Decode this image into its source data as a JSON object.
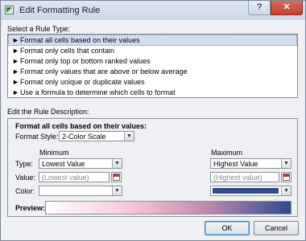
{
  "window": {
    "title": "Edit Formatting Rule",
    "help_label": "?",
    "close_label": "✕"
  },
  "select_rule_type": {
    "label": "Select a Rule Type:",
    "items": [
      {
        "label": "Format all cells based on their values",
        "selected": true
      },
      {
        "label": "Format only cells that contain",
        "selected": false
      },
      {
        "label": "Format only top or bottom ranked values",
        "selected": false
      },
      {
        "label": "Format only values that are above or below average",
        "selected": false
      },
      {
        "label": "Format only unique or duplicate values",
        "selected": false
      },
      {
        "label": "Use a formula to determine which cells to format",
        "selected": false
      }
    ],
    "arrow_glyph": "►"
  },
  "edit_description": {
    "label": "Edit the Rule Description:",
    "heading": "Format all cells based on their values:",
    "format_style_label": "Format Style:",
    "format_style_value": "2-Color Scale",
    "minimum_header": "Minimum",
    "maximum_header": "Maximum",
    "type_label": "Type:",
    "value_label": "Value:",
    "color_label": "Color:",
    "min_type": "Lowest Value",
    "max_type": "Highest Value",
    "min_value_placeholder": "(Lowest value)",
    "max_value_placeholder": "(Highest value)",
    "min_color": "#ffffff",
    "max_color": "#2f4a8f",
    "preview_label": "Preview:"
  },
  "buttons": {
    "ok": "OK",
    "cancel": "Cancel"
  },
  "icons": {
    "dropdown": "▼"
  }
}
